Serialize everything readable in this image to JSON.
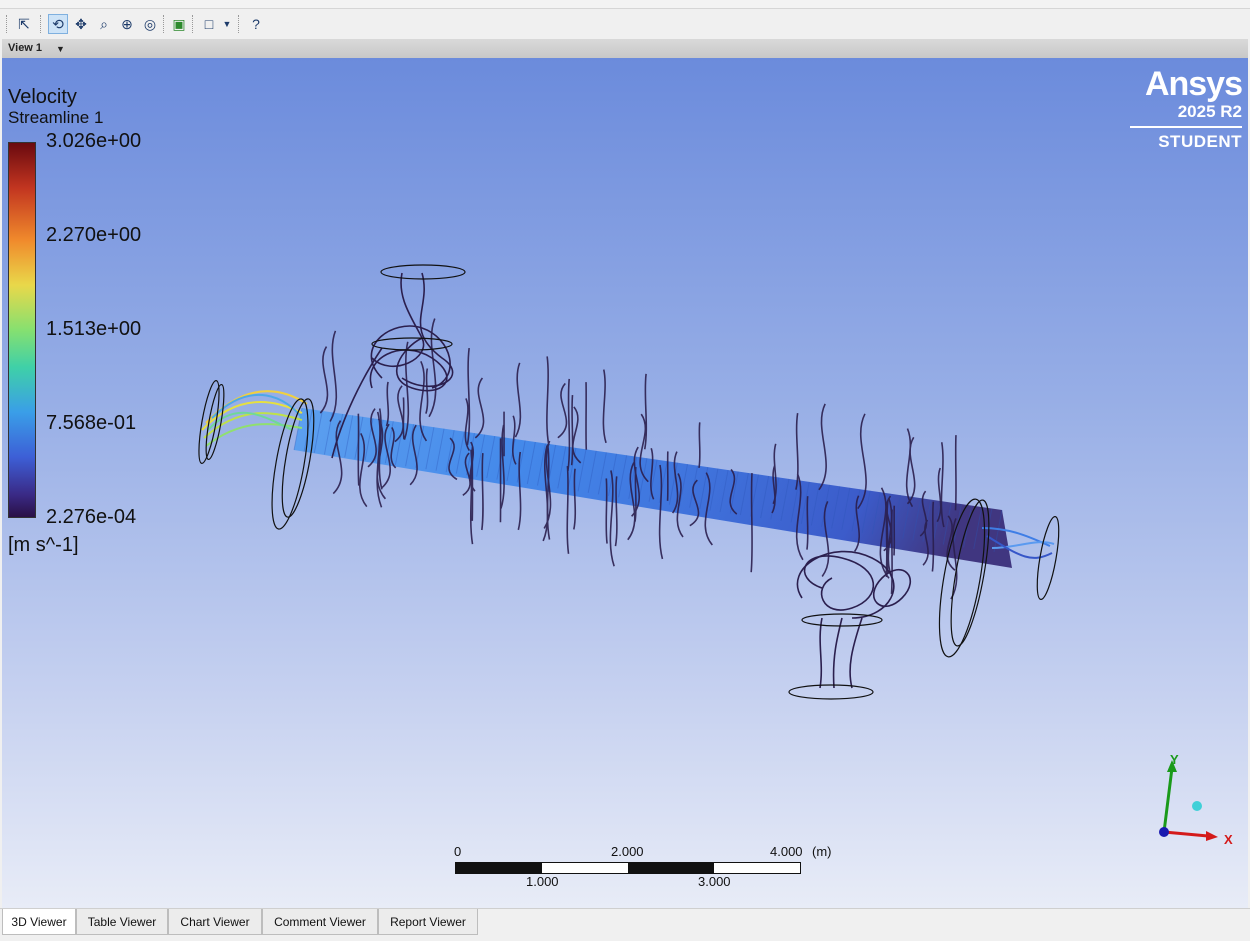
{
  "toolbar": {
    "icons": [
      "select-icon",
      "rotate-icon",
      "pan-icon",
      "zoom-icon",
      "zoom-box-icon",
      "zoom-fit-icon",
      "fit-view-icon",
      "viewport-layout-icon",
      "help-pointer-icon"
    ],
    "active_tool": "rotate-icon"
  },
  "view": {
    "label": "View 1"
  },
  "legend": {
    "title": "Velocity",
    "subtitle": "Streamline 1",
    "ticks": [
      "3.026e+00",
      "2.270e+00",
      "1.513e+00",
      "7.568e-01",
      "2.276e-04"
    ],
    "units": "[m s^-1]"
  },
  "logo": {
    "brand": "Ansys",
    "version": "2025 R2",
    "edition": "STUDENT"
  },
  "scale_bar": {
    "top_labels": [
      "0",
      "2.000",
      "4.000"
    ],
    "bottom_labels": [
      "1.000",
      "3.000"
    ],
    "unit": "(m)"
  },
  "axes": {
    "x": "X",
    "y": "Y"
  },
  "tabs": [
    {
      "label": "3D Viewer",
      "active": true
    },
    {
      "label": "Table Viewer",
      "active": false
    },
    {
      "label": "Chart Viewer",
      "active": false
    },
    {
      "label": "Comment Viewer",
      "active": false
    },
    {
      "label": "Report Viewer",
      "active": false
    }
  ],
  "colors": {
    "viewport_top": "#6b8bdc",
    "viewport_bottom": "#e8ecf7",
    "streamline_dark": "#2b1f4e",
    "tube_blue": "#3f7ee6"
  }
}
